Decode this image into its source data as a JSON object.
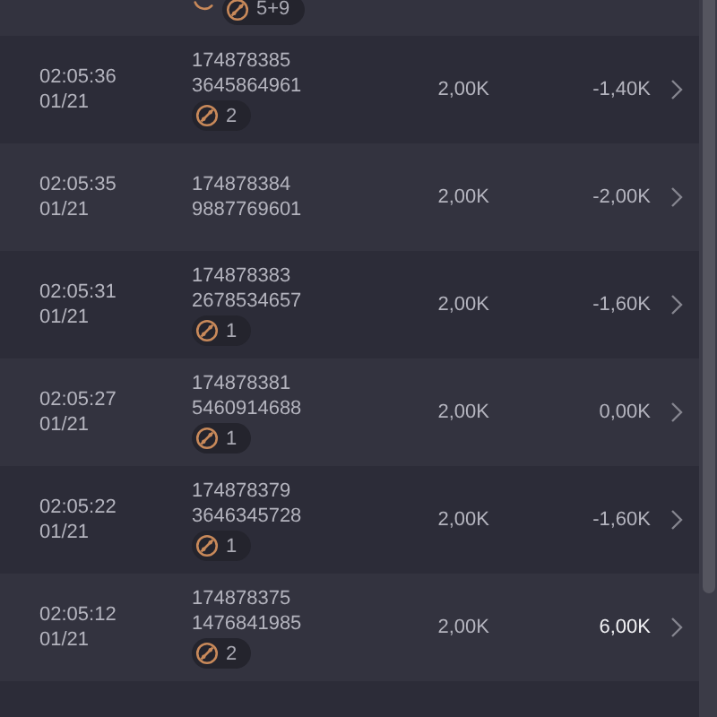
{
  "top_row": {
    "badge": "5+9"
  },
  "rows": [
    {
      "time": "02:05:36",
      "date": "01/21",
      "id": "174878385",
      "number": "3645864961",
      "badge": "2",
      "amount": "2,00K",
      "result": "-1,40K",
      "positive": false
    },
    {
      "time": "02:05:35",
      "date": "01/21",
      "id": "174878384",
      "number": "9887769601",
      "amount": "2,00K",
      "result": "-2,00K",
      "positive": false
    },
    {
      "time": "02:05:31",
      "date": "01/21",
      "id": "174878383",
      "number": "2678534657",
      "badge": "1",
      "amount": "2,00K",
      "result": "-1,60K",
      "positive": false
    },
    {
      "time": "02:05:27",
      "date": "01/21",
      "id": "174878381",
      "number": "5460914688",
      "badge": "1",
      "amount": "2,00K",
      "result": "0,00K",
      "positive": false
    },
    {
      "time": "02:05:22",
      "date": "01/21",
      "id": "174878379",
      "number": "3646345728",
      "badge": "1",
      "amount": "2,00K",
      "result": "-1,60K",
      "positive": false
    },
    {
      "time": "02:05:12",
      "date": "01/21",
      "id": "174878375",
      "number": "1476841985",
      "badge": "2",
      "amount": "2,00K",
      "result": "6,00K",
      "positive": true
    }
  ]
}
